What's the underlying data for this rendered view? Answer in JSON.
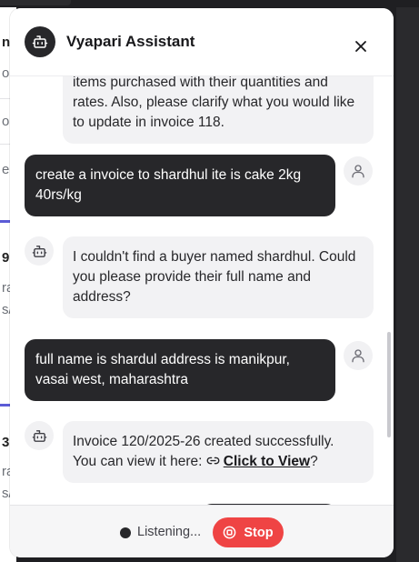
{
  "header": {
    "title": "Vyapari Assistant",
    "avatar_icon": "bot-icon",
    "close_icon": "close-icon"
  },
  "background_fragments": [
    "n",
    "o",
    "e",
    "9,",
    "ra",
    "s/",
    "3,",
    "ra",
    "s/"
  ],
  "messages": [
    {
      "role": "bot",
      "text": "items purchased with their quantities and rates.  Also, please clarify what you would like to update in invoice 118."
    },
    {
      "role": "user",
      "text": "create a invoice to shardhul ite is cake 2kg 40rs/kg"
    },
    {
      "role": "bot",
      "text": "I couldn't find a buyer named shardhul. Could you please provide their full name and address?"
    },
    {
      "role": "user",
      "text": "full name is shardul address is manikpur, vasai west, maharashtra"
    },
    {
      "role": "bot",
      "text_before": "Invoice 120/2025-26 created successfully. You can view it here: ",
      "link_text": "Click to View",
      "text_after": "?"
    }
  ],
  "footer": {
    "status_text": "Listening...",
    "stop_label": "Stop"
  },
  "colors": {
    "dark": "#27272a",
    "bot_bubble": "#f2f2f4",
    "stop_button": "#ef4444"
  }
}
